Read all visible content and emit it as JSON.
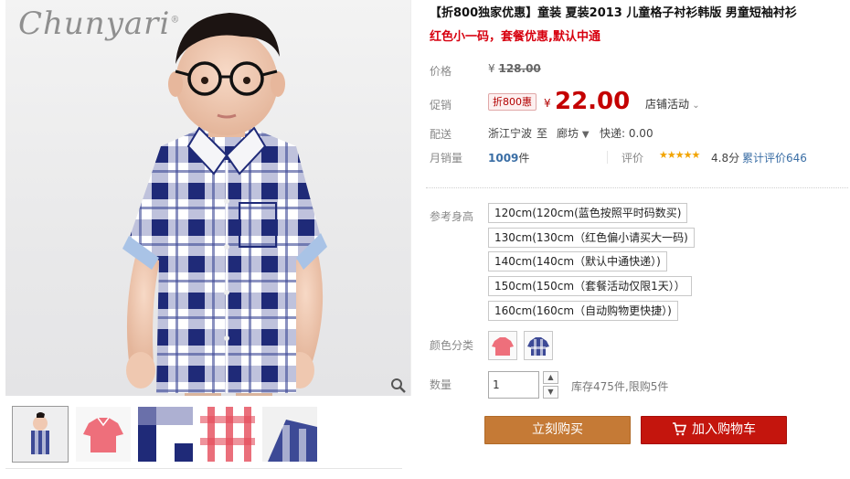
{
  "brand": {
    "logo_text": "Chunyari"
  },
  "product": {
    "title": "【折800独家优惠】童装 夏装2013 儿童格子衬衫韩版 男童短袖衬衫",
    "subtitle": "红色小一码，套餐优惠,默认中通"
  },
  "price": {
    "label": "价格",
    "currency": "¥",
    "original": "128.00"
  },
  "promo": {
    "label": "促销",
    "badge": "折800惠",
    "currency": "¥",
    "price": "22.00",
    "store_activity": "店铺活动"
  },
  "shipping": {
    "label": "配送",
    "from": "浙江宁波",
    "to_word": "至",
    "destination": "廊坊",
    "express": "快递: 0.00"
  },
  "sales": {
    "label": "月销量",
    "count": "1009",
    "unit": "件",
    "rating_label": "评价",
    "stars": "★★★★★",
    "rating": "4.8分",
    "reviews": "累计评价646"
  },
  "sizes": {
    "label": "参考身高",
    "options": [
      "120cm(120cm(蓝色按照平时码数买)",
      "130cm(130cm（红色偏小请买大一码)",
      "140cm(140cm（默认中通快递）)",
      "150cm(150cm（套餐活动仅限1天））",
      "160cm(160cm（自动购物更快捷）)"
    ]
  },
  "colors": {
    "label": "颜色分类",
    "options": [
      "red-plaid",
      "blue-plaid"
    ]
  },
  "quantity": {
    "label": "数量",
    "value": "1",
    "stock": "库存475件,限购5件"
  },
  "actions": {
    "buy_now": "立刻购买",
    "add_to_cart": "加入购物车"
  },
  "theme": {
    "price_red": "#c40000",
    "buy_now_color": "#c57a36",
    "cart_color": "#c4150d",
    "link_blue": "#3a6ea5",
    "star_color": "#f2a400"
  }
}
